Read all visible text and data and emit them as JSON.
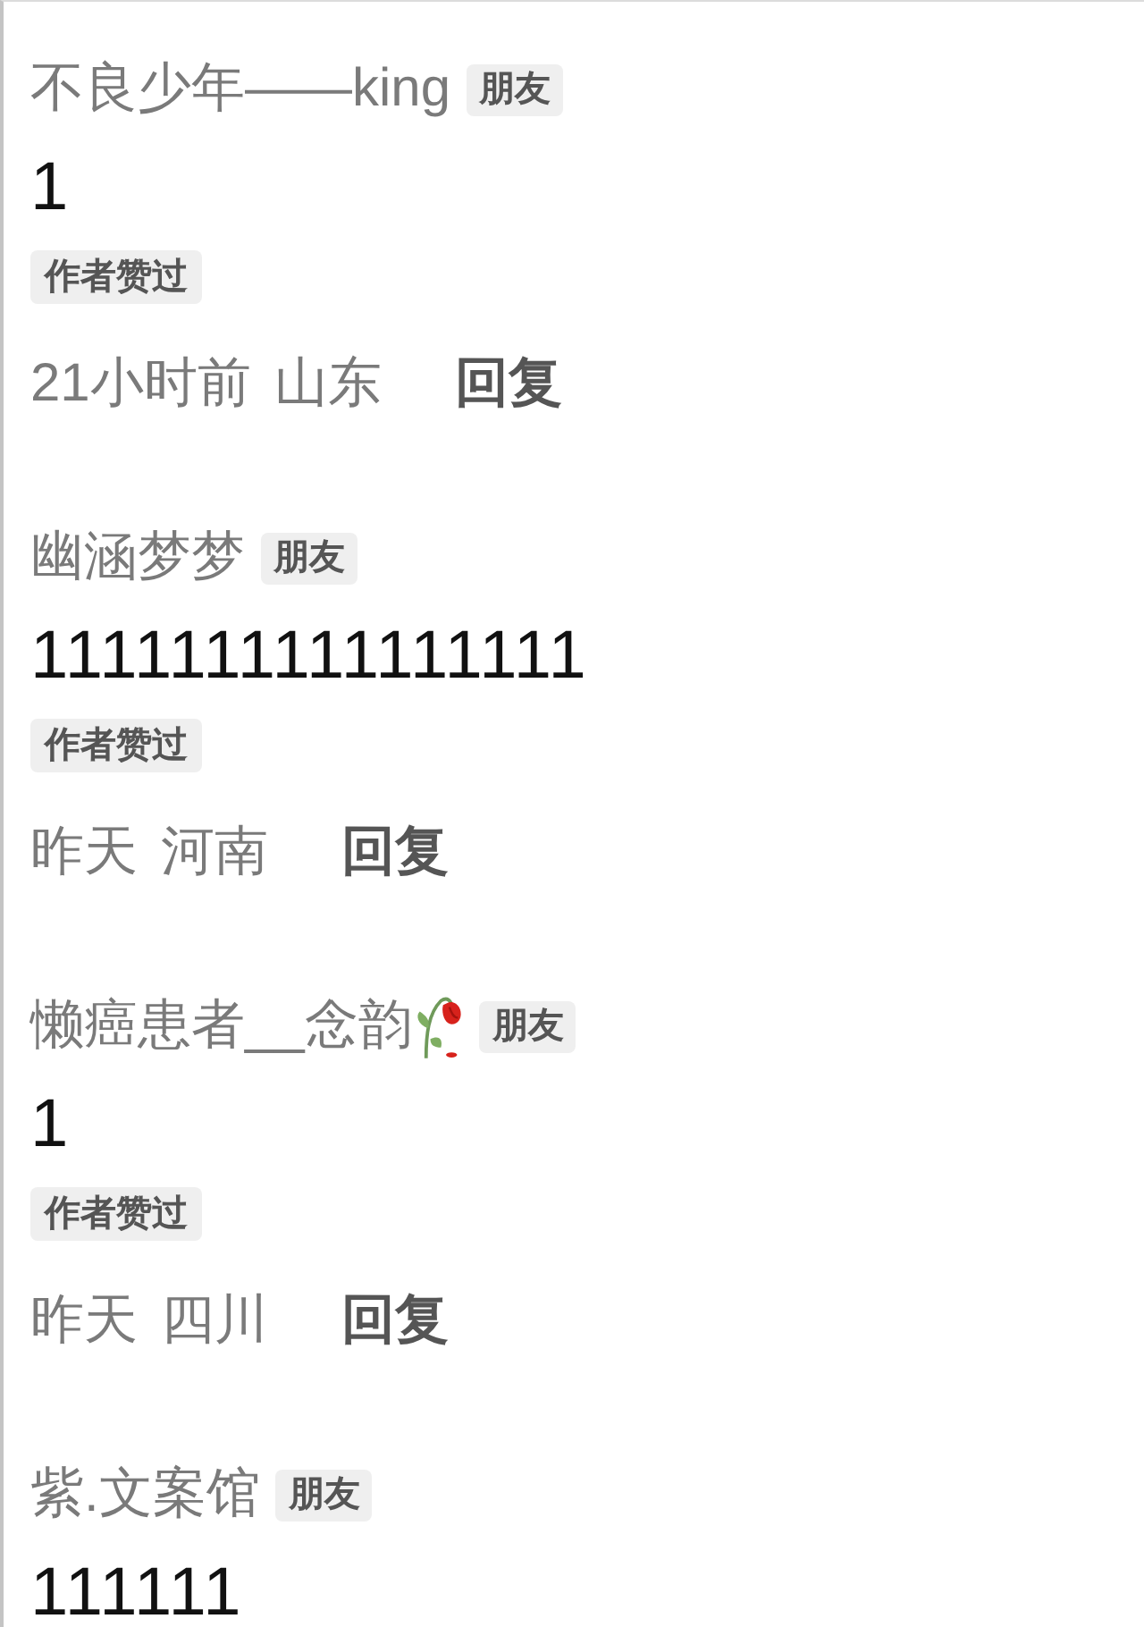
{
  "comments": [
    {
      "author": "不良少年——king",
      "name_emoji": false,
      "tag": "朋友",
      "text": "1",
      "badge": "作者赞过",
      "time": "21小时前",
      "location": "山东",
      "reply": "回复"
    },
    {
      "author": "幽涵梦梦",
      "name_emoji": false,
      "tag": "朋友",
      "text": "1111111111111111",
      "badge": "作者赞过",
      "time": "昨天",
      "location": "河南",
      "reply": "回复"
    },
    {
      "author": "懒癌患者__念韵",
      "name_emoji": true,
      "tag": "朋友",
      "text": "1",
      "badge": "作者赞过",
      "time": "昨天",
      "location": "四川",
      "reply": "回复"
    },
    {
      "author": "紫.文案馆",
      "name_emoji": false,
      "tag": "朋友",
      "text": "111111"
    }
  ]
}
